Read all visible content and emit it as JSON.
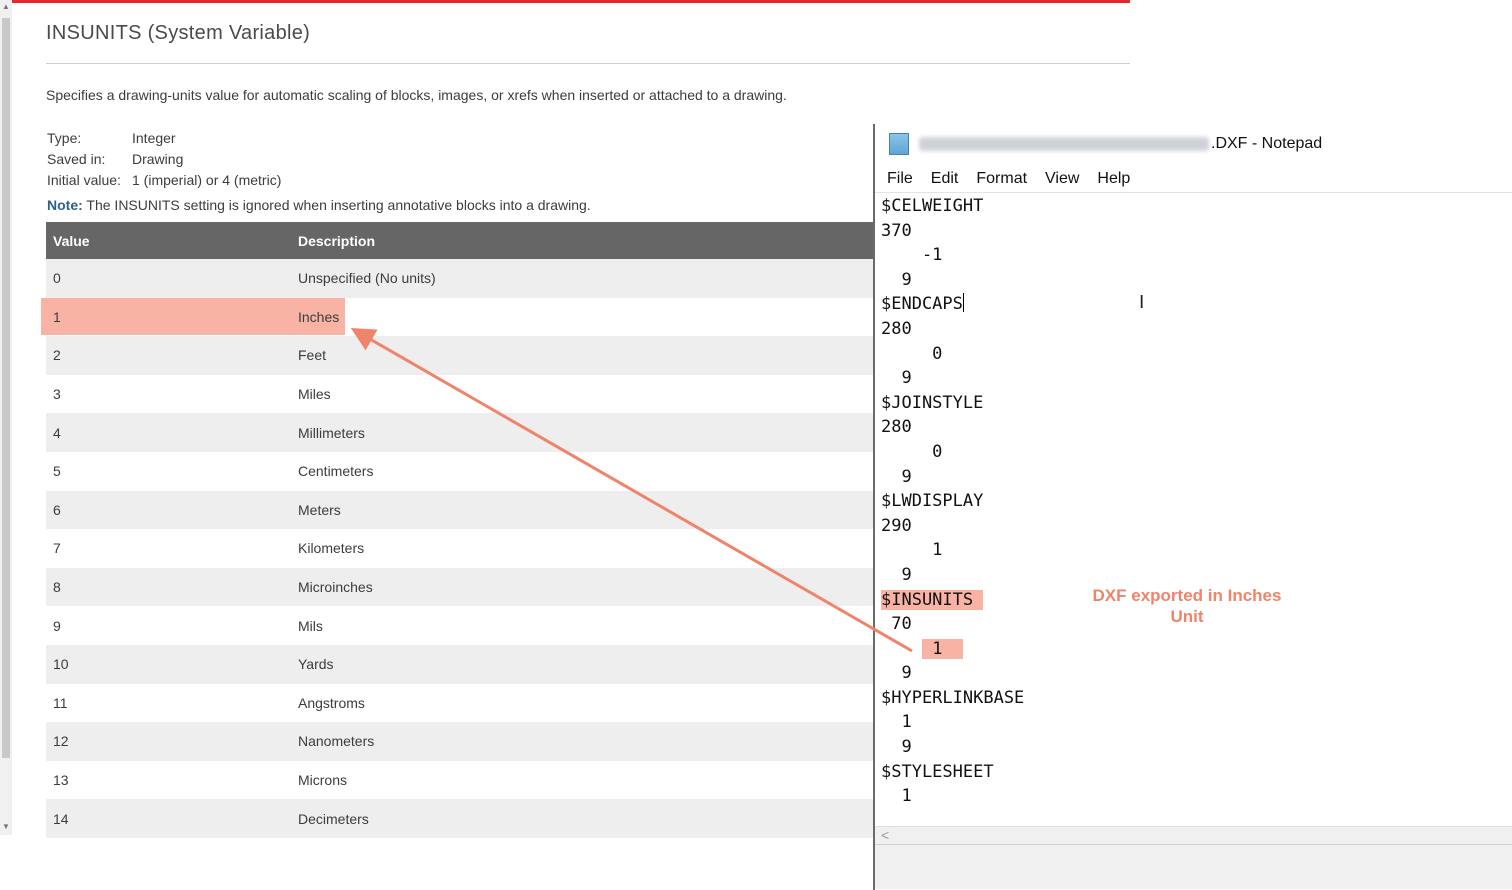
{
  "doc": {
    "title": "INSUNITS (System Variable)",
    "description": "Specifies a drawing-units value for automatic scaling of blocks, images, or xrefs when inserted or attached to a drawing.",
    "properties": [
      {
        "key": "Type:",
        "value": "Integer"
      },
      {
        "key": "Saved in:",
        "value": "Drawing"
      },
      {
        "key": "Initial value:",
        "value": "1 (imperial) or 4 (metric)"
      }
    ],
    "note_label": "Note:",
    "note_text": " The INSUNITS setting is ignored when inserting annotative blocks into a drawing."
  },
  "table": {
    "headers": [
      "Value",
      "Description"
    ],
    "rows": [
      {
        "value": "0",
        "description": "Unspecified (No units)"
      },
      {
        "value": "1",
        "description": "Inches"
      },
      {
        "value": "2",
        "description": "Feet"
      },
      {
        "value": "3",
        "description": "Miles"
      },
      {
        "value": "4",
        "description": "Millimeters"
      },
      {
        "value": "5",
        "description": "Centimeters"
      },
      {
        "value": "6",
        "description": "Meters"
      },
      {
        "value": "7",
        "description": "Kilometers"
      },
      {
        "value": "8",
        "description": "Microinches"
      },
      {
        "value": "9",
        "description": "Mils"
      },
      {
        "value": "10",
        "description": "Yards"
      },
      {
        "value": "11",
        "description": "Angstroms"
      },
      {
        "value": "12",
        "description": "Nanometers"
      },
      {
        "value": "13",
        "description": "Microns"
      },
      {
        "value": "14",
        "description": "Decimeters"
      }
    ]
  },
  "notepad": {
    "title_suffix": ".DXF - Notepad",
    "menu": [
      "File",
      "Edit",
      "Format",
      "View",
      "Help"
    ],
    "lines": {
      "l01": "$CELWEIGHT",
      "l02": "370",
      "l03": "    -1",
      "l04": "  9",
      "l05": "$ENDCAPS",
      "l06": "280",
      "l07": "     0",
      "l08": "  9",
      "l09": "$JOINSTYLE",
      "l10": "280",
      "l11": "     0",
      "l12": "  9",
      "l13": "$LWDISPLAY",
      "l14": "290",
      "l15": "     1",
      "l16": "  9",
      "l17": "$INSUNITS ",
      "l18": " 70",
      "l19_pre": "    ",
      "l19_val": " 1  ",
      "l20": "  9",
      "l21": "$HYPERLINKBASE",
      "l22": "  1",
      "l23": "",
      "l24": "  9",
      "l25": "$STYLESHEET",
      "l26": "  1"
    },
    "hscroll_left": "<"
  },
  "annotation": {
    "line1": "DXF exported in Inches",
    "line2": "Unit"
  },
  "colors": {
    "accent_bar": "#e8252a",
    "highlight": "#f8b3a5",
    "annotation": "#f0846a",
    "table_header": "#666666"
  }
}
